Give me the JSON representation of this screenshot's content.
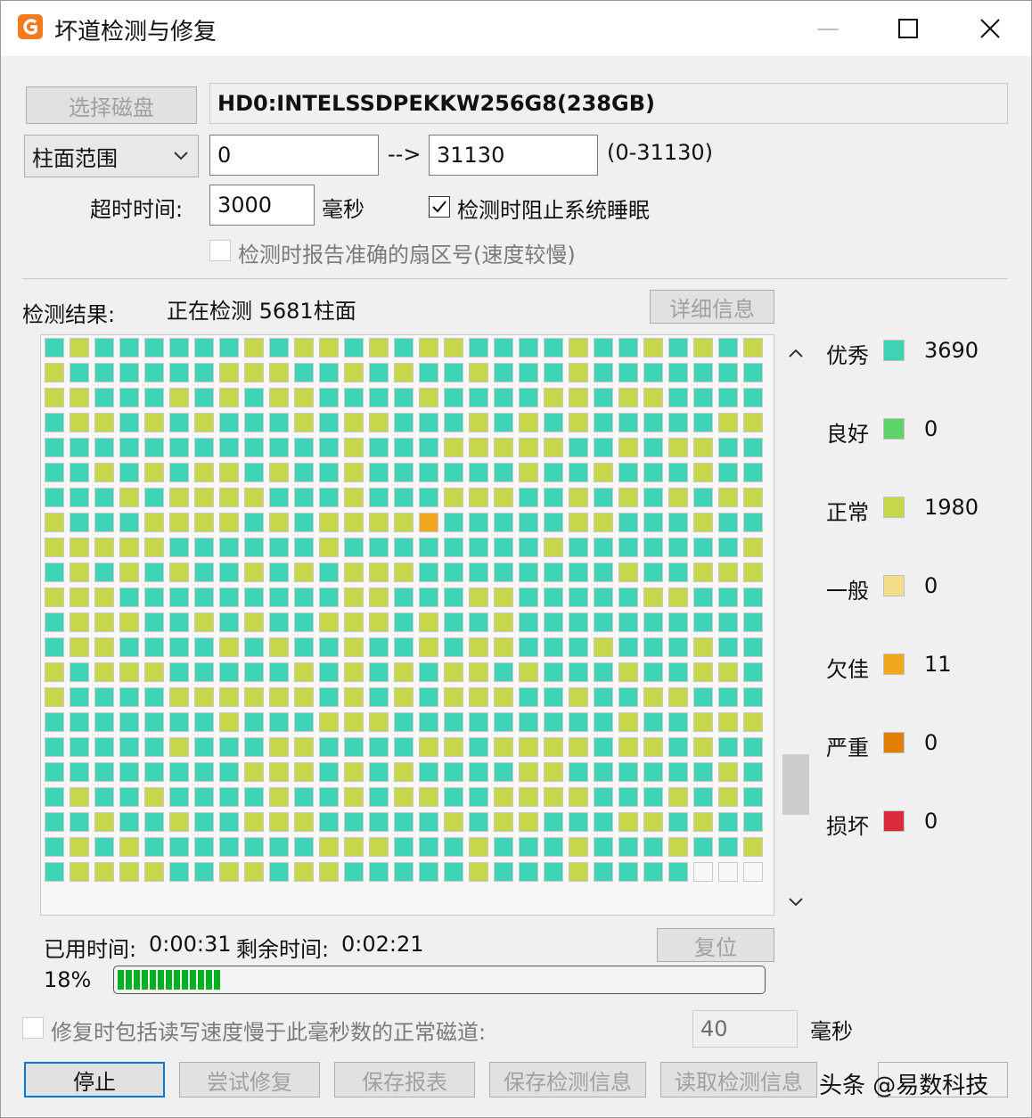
{
  "window": {
    "title": "坏道检测与修复",
    "minimize_glyph": "—",
    "maximize_glyph": "☐",
    "close_glyph": "✕",
    "app_icon": "disk-genius-icon"
  },
  "disk": {
    "select_button": "选择磁盘",
    "selected": "HD0:INTELSSDPEKKW256G8(238GB)"
  },
  "range": {
    "mode": "柱面范围",
    "start": "0",
    "arrow": "-->",
    "end": "31130",
    "hint": "(0-31130)"
  },
  "timeout": {
    "label": "超时时间:",
    "value": "3000",
    "unit": "毫秒"
  },
  "options": {
    "prevent_sleep": "检测时阻止系统睡眠",
    "prevent_sleep_checked": true,
    "report_sector": "检测时报告准确的扇区号(速度较慢)",
    "report_sector_checked": false
  },
  "result": {
    "label": "检测结果:",
    "status": "正在检测 5681柱面",
    "details_button": "详细信息"
  },
  "grid": {
    "cols": 29,
    "rows": 22,
    "colors": {
      "excellent": "#3ed3b5",
      "good": "#5fd36b",
      "normal": "#c6d84a",
      "fair": "#f5de8a",
      "poor": "#f2a81e",
      "severe": "#e47e00",
      "damaged": "#d92b3a",
      "empty": "#f7f7f7"
    }
  },
  "legend": [
    {
      "name": "优秀",
      "color": "#3ed3b5",
      "count": "3690"
    },
    {
      "name": "良好",
      "color": "#5fd36b",
      "count": "0"
    },
    {
      "name": "正常",
      "color": "#c6d84a",
      "count": "1980"
    },
    {
      "name": "一般",
      "color": "#f5de8a",
      "count": "0"
    },
    {
      "name": "欠佳",
      "color": "#f2a81e",
      "count": "11"
    },
    {
      "name": "严重",
      "color": "#e47e00",
      "count": "0"
    },
    {
      "name": "损坏",
      "color": "#d92b3a",
      "count": "0"
    }
  ],
  "scroll": {
    "up_glyph": "˄",
    "down_glyph": "˅",
    "position": 0.85
  },
  "timing": {
    "elapsed_label": "已用时间:",
    "elapsed": "0:00:31",
    "remaining_label": "剩余时间:",
    "remaining": "0:02:21",
    "reset_button": "复位"
  },
  "progress": {
    "percent_text": "18%",
    "value": 0.18
  },
  "repair": {
    "include_slow": "修复时包括读写速度慢于此毫秒数的正常磁道:",
    "include_slow_checked": false,
    "threshold": "40",
    "unit": "毫秒"
  },
  "buttons": {
    "stop": "停止",
    "try_repair": "尝试修复",
    "save_report": "保存报表",
    "save_info": "保存检测信息",
    "load_info": "读取检测信息"
  },
  "watermark": "头条 @易数科技"
}
